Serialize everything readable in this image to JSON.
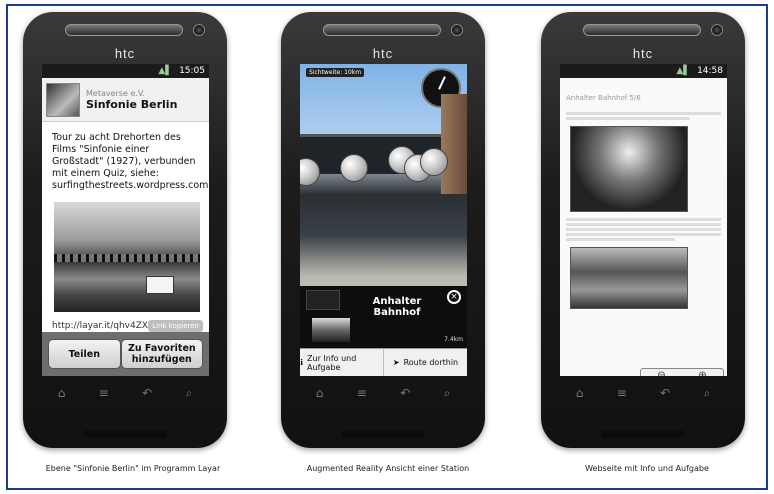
{
  "phones": {
    "brand": "htc",
    "nav_icons": [
      "⌂",
      "≡",
      "↶",
      "⌕"
    ]
  },
  "screen1": {
    "status_time": "15:05",
    "publisher": "Metaverse e.V.",
    "title": "Sinfonie Berlin",
    "description": "Tour zu acht Drehorten des Films \"Sinfonie einer Großstadt\" (1927), verbunden mit einem Quiz, siehe: surfingthestreets.wordpress.com",
    "url": "http://layar.it/qhv4ZX",
    "copy_link_label": "Link kopieren",
    "share_button": "Teilen",
    "favorites_button": "Zu Favoriten hinzufügen"
  },
  "screen2": {
    "range_label": "Sichtweite: 10km",
    "station_name": "Anhalter Bahnhof",
    "distance": "7.4km",
    "info_button": "Zur Info und Aufgabe",
    "route_button": "Route dorthin"
  },
  "screen3": {
    "status_time": "14:58",
    "page_title": "Anhalter Bahnhof 5/6"
  },
  "captions": [
    "Ebene \"Sinfonie Berlin\" im Programm Layar",
    "Augmented Reality Ansicht einer Station",
    "Webseite mit Info und Aufgabe"
  ],
  "colors": {
    "frame_border": "#1a3c8c"
  }
}
